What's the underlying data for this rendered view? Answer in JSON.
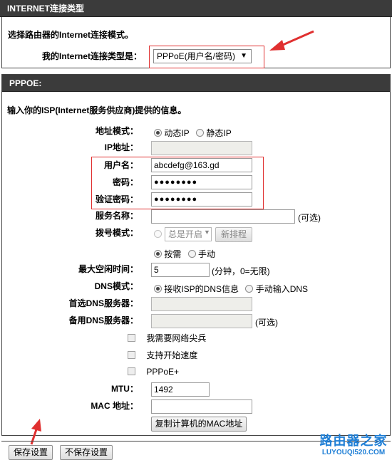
{
  "conn_section": {
    "title": "INTERNET连接类型",
    "description": "选择路由器的Internet连接模式。",
    "type_label": "我的Internet连接类型是：",
    "type_value": "PPPoE(用户名/密码)",
    "dropdown_arrow": "▼"
  },
  "pppoe_section": {
    "title": "PPPOE:",
    "description": "输入你的ISP(Internet服务供应商)提供的信息。"
  },
  "form": {
    "address_mode_label": "地址模式",
    "address_mode_options": [
      "动态IP",
      "静态IP"
    ],
    "ip_label": "IP地址",
    "username_label": "用户名",
    "username_value": "abcdefg@163.gd",
    "password_label": "密码",
    "password_mask": "●●●●●●●●",
    "verify_label": "验证密码",
    "verify_mask": "●●●●●●●●",
    "service_label": "服务名称",
    "optional": "(可选)",
    "dial_label": "拨号模式",
    "dial_select": "总是开启",
    "new_schedule": "新排程",
    "dial_options": [
      "按需",
      "手动"
    ],
    "idle_label": "最大空闲时间",
    "idle_value": "5",
    "idle_unit": "(分钟，0=无限)",
    "dns_mode_label": "DNS模式",
    "dns_options": [
      "接收ISP的DNS信息",
      "手动输入DNS"
    ],
    "primary_dns_label": "首选DNS服务器",
    "secondary_dns_label": "备用DNS服务器",
    "check_unicast": "我需要网络尖兵",
    "check_speedup": "支持开始速度",
    "check_pppoe_plus": "PPPoE+",
    "mtu_label": "MTU",
    "mtu_value": "1492",
    "mac_label": "MAC 地址",
    "copy_mac": "复制计算机的MAC地址"
  },
  "buttons": {
    "save": "保存设置",
    "dont_save": "不保存设置"
  },
  "watermark": {
    "text": "路由器之家",
    "url": "LUYOUQI520.COM"
  },
  "colors": {
    "header_bg": "#3b3b3b",
    "highlight_red": "#e03030"
  }
}
